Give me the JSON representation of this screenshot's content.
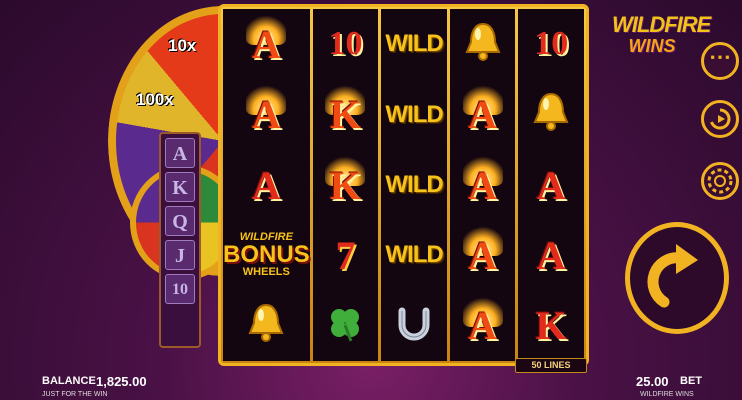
{
  "wheel": {
    "segments": [
      "10x",
      "100x"
    ]
  },
  "side_column": [
    "A",
    "K",
    "Q",
    "J",
    "10"
  ],
  "reels": [
    [
      {
        "type": "letter",
        "text": "A",
        "fire": true
      },
      {
        "type": "letter",
        "text": "A",
        "fire": true
      },
      {
        "type": "letter",
        "text": "A",
        "fire": false
      },
      {
        "type": "bonus",
        "top": "WILDFIRE",
        "main": "BONUS",
        "bottom": "WHEELS"
      },
      {
        "type": "icon",
        "icon": "bell-icon"
      }
    ],
    [
      {
        "type": "num",
        "text": "10"
      },
      {
        "type": "letter",
        "text": "K",
        "fire": true
      },
      {
        "type": "letter",
        "text": "K",
        "fire": true
      },
      {
        "type": "seven",
        "text": "7"
      },
      {
        "type": "icon",
        "icon": "clover-icon"
      }
    ],
    [
      {
        "type": "wild",
        "text": "WILD"
      },
      {
        "type": "wild",
        "text": "WILD"
      },
      {
        "type": "wild",
        "text": "WILD"
      },
      {
        "type": "wild",
        "text": "WILD"
      },
      {
        "type": "icon",
        "icon": "horseshoe-icon"
      }
    ],
    [
      {
        "type": "icon",
        "icon": "bell-icon"
      },
      {
        "type": "letter",
        "text": "A",
        "fire": true
      },
      {
        "type": "letter",
        "text": "A",
        "fire": true
      },
      {
        "type": "letter",
        "text": "A",
        "fire": true
      },
      {
        "type": "letter",
        "text": "A",
        "fire": true
      }
    ],
    [
      {
        "type": "num",
        "text": "10"
      },
      {
        "type": "icon",
        "icon": "bell-icon"
      },
      {
        "type": "letter",
        "text": "A",
        "fire": false
      },
      {
        "type": "letter",
        "text": "A",
        "fire": false
      },
      {
        "type": "letter",
        "text": "K",
        "fire": false
      }
    ]
  ],
  "lines_label": "50 LINES",
  "logo": {
    "line1": "WILDFIRE",
    "line2": "WINS"
  },
  "footer": {
    "balance_label": "BALANCE",
    "balance_value": "1,825.00",
    "tagline": "JUST FOR THE WIN",
    "bet_value": "25.00",
    "bet_label": "BET",
    "game_name": "WILDFIRE WINS"
  },
  "colors": {
    "gold": "#f2b322",
    "red": "#e32b1d",
    "purple": "#4a1146"
  }
}
